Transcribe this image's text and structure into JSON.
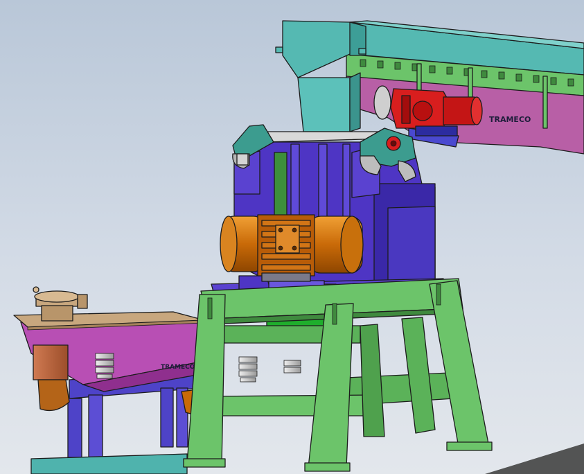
{
  "scene": {
    "type": "cad-3d-assembly",
    "background_color": "#cbd4df",
    "components": [
      {
        "name": "feed-hopper",
        "color": "#4fb3ad"
      },
      {
        "name": "belt-conveyor",
        "color": "#4fb3ad"
      },
      {
        "name": "conveyor-side-guard",
        "color": "#b85fa6"
      },
      {
        "name": "conveyor-drive-gearmotor",
        "color": "#d81e1e"
      },
      {
        "name": "crusher-body",
        "color": "#4e35c4"
      },
      {
        "name": "bearing-housing",
        "color": "#3c9c8f"
      },
      {
        "name": "vibration-motor",
        "color": "#d4740c"
      },
      {
        "name": "support-frame",
        "color": "#6cc46a"
      },
      {
        "name": "vibrating-screen",
        "color": "#b84fb4"
      },
      {
        "name": "screen-deck",
        "color": "#c8a77e"
      },
      {
        "name": "support-springs",
        "color": "#cfcfcf"
      }
    ]
  },
  "labels": {
    "brand_logo": "TRAMECO"
  }
}
